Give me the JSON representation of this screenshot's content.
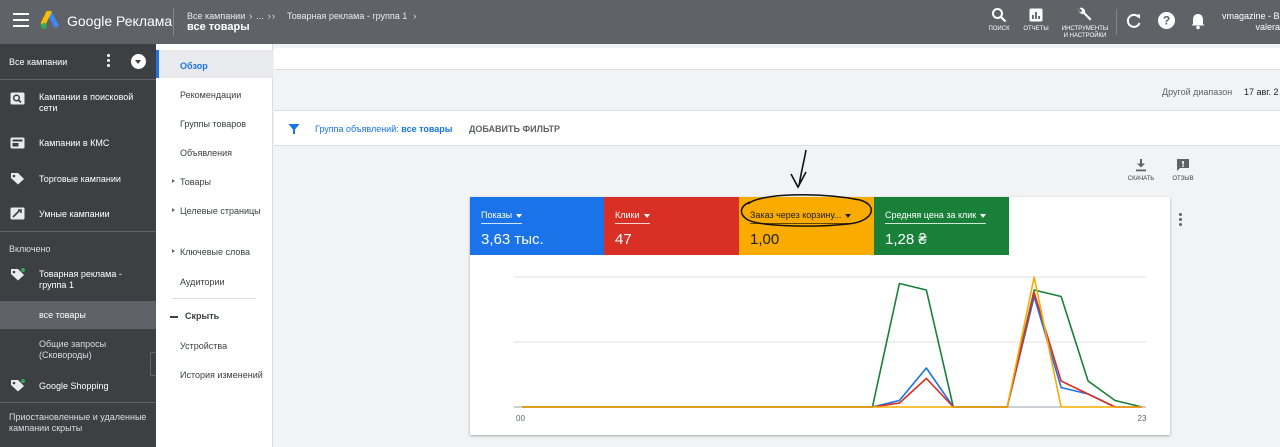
{
  "topbar": {
    "brand": "Google Реклама",
    "breadcrumb_root": "Все кампании",
    "breadcrumb_ellipsis": "...",
    "breadcrumb_group": "Товарная реклама - группа 1",
    "breadcrumb_current": "все товары",
    "tools": {
      "search": "ПОИСК",
      "reports": "ОТЧЕТЫ",
      "settings_line1": "ИНСТРУМЕНТЫ",
      "settings_line2": "И НАСТРОЙКИ"
    },
    "account_line1": "vmagazine - Ba",
    "account_line2": "valera"
  },
  "leftnav": {
    "all_campaigns": "Все кампании",
    "items": [
      {
        "label": "Кампании в поисковой сети",
        "icon": "search-campaign-icon"
      },
      {
        "label": "Кампании в КМС",
        "icon": "display-campaign-icon"
      },
      {
        "label": "Торговые кампании",
        "icon": "shopping-tag-icon"
      },
      {
        "label": "Умные кампании",
        "icon": "smart-campaign-icon"
      }
    ],
    "section_enabled": "Включено",
    "enabled_items": [
      {
        "label": "Товарная реклама - группа 1",
        "icon": "shopping-tag-icon"
      },
      {
        "label": "все товары"
      },
      {
        "label": "Общие запросы (Сковороды)"
      },
      {
        "label": "Google Shopping",
        "icon": "shopping-tag-icon"
      }
    ],
    "paused": "Приостановленные и удаленные кампании скрыты"
  },
  "subnav": {
    "items": [
      "Обзор",
      "Рекомендации",
      "Группы товаров",
      "Объявления",
      "Товары",
      "Целевые страницы",
      "Ключевые слова",
      "Аудитории"
    ],
    "hide": "Скрыть",
    "bottom_items": [
      "Устройства",
      "История изменений"
    ]
  },
  "main": {
    "range_label": "Другой диапазон",
    "range_value": "17 авг. 2",
    "filter_label": "Группа объявлений:",
    "filter_value": "все товары",
    "add_filter": "ДОБАВИТЬ ФИЛЬТР",
    "download": "СКАЧАТЬ",
    "feedback": "ОТЗЫВ"
  },
  "metrics": [
    {
      "label": "Показы",
      "value": "3,63 тыс.",
      "color": "#1a73e8"
    },
    {
      "label": "Клики",
      "value": "47",
      "color": "#d93025"
    },
    {
      "label": "Заказ через корзину...",
      "value": "1,00",
      "color": "#f9ab00"
    },
    {
      "label": "Средняя цена за клик",
      "value": "1,28 ₴",
      "color": "#188038"
    }
  ],
  "chart_data": {
    "type": "line",
    "x": [
      0,
      1,
      2,
      3,
      4,
      5,
      6,
      7,
      8,
      9,
      10,
      11,
      12,
      13,
      14,
      15,
      16,
      17,
      18,
      19,
      20,
      21,
      22,
      23
    ],
    "xtick_labels": [
      "00",
      "23"
    ],
    "ylim": [
      0,
      1
    ],
    "grid": true,
    "series": [
      {
        "color": "#188038",
        "values": [
          0,
          0,
          0,
          0,
          0,
          0,
          0,
          0,
          0,
          0,
          0,
          0,
          0,
          0,
          0.95,
          0.9,
          0,
          0,
          0,
          0.9,
          0.85,
          0.2,
          0.05,
          0
        ]
      },
      {
        "color": "#1a73e8",
        "values": [
          0,
          0,
          0,
          0,
          0,
          0,
          0,
          0,
          0,
          0,
          0,
          0,
          0,
          0,
          0.05,
          0.3,
          0,
          0,
          0,
          0.85,
          0.15,
          0.1,
          0,
          0
        ]
      },
      {
        "color": "#d93025",
        "values": [
          0,
          0,
          0,
          0,
          0,
          0,
          0,
          0,
          0,
          0,
          0,
          0,
          0,
          0,
          0.03,
          0.22,
          0,
          0,
          0,
          0.88,
          0.2,
          0.1,
          0,
          0
        ]
      },
      {
        "color": "#f9ab00",
        "values": [
          0,
          0,
          0,
          0,
          0,
          0,
          0,
          0,
          0,
          0,
          0,
          0,
          0,
          0,
          0,
          0,
          0,
          0,
          0,
          1,
          0,
          0,
          0,
          0
        ]
      }
    ]
  }
}
